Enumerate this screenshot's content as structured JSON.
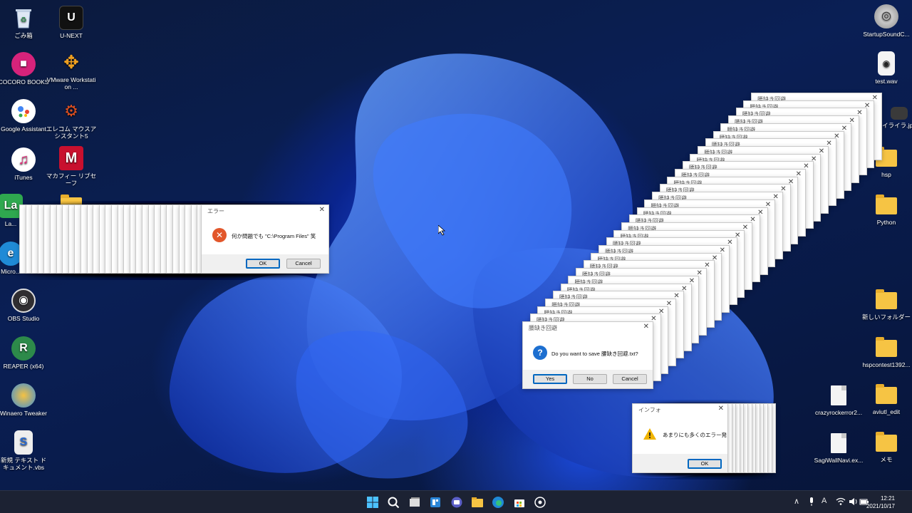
{
  "desktop": {
    "left_icons": [
      {
        "label": "ごみ箱",
        "icon": "recycle-bin-icon",
        "color": "#2b2b2b"
      },
      {
        "label": "U-NEXT",
        "icon": "unext-icon",
        "color": "#111111"
      },
      {
        "label": "COCORO BOOKS",
        "icon": "cocoro-books-icon",
        "color": "#d7237b"
      },
      {
        "label": "VMware Workstation ...",
        "icon": "vmware-icon",
        "color": "#f0a020"
      },
      {
        "label": "Google Assistant",
        "icon": "google-assistant-icon",
        "color": "#ffffff"
      },
      {
        "label": "エレコム マウスアシスタント5",
        "icon": "elecom-icon",
        "color": "#333333"
      },
      {
        "label": "iTunes",
        "icon": "itunes-icon",
        "color": "#ffffff"
      },
      {
        "label": "マカフィー リブセーフ",
        "icon": "mcafee-icon",
        "color": "#c8102e"
      },
      {
        "label": "La...",
        "icon": "la-icon",
        "color": "#2fa84f"
      },
      {
        "label": "Micro...",
        "icon": "edge-icon",
        "color": "#1f8ad6"
      },
      {
        "label": "OBS Studio",
        "icon": "obs-icon",
        "color": "#302e31"
      },
      {
        "label": "REAPER (x64)",
        "icon": "reaper-icon",
        "color": "#2d8a4a"
      },
      {
        "label": "Winaero Tweaker",
        "icon": "winaero-icon",
        "color": "#3c8fd8"
      },
      {
        "label": "新規 テキスト ドキュメント.vbs",
        "icon": "vbs-file-icon",
        "color": "#eeeeee"
      }
    ],
    "right_icons": [
      {
        "label": "StartupSoundC...",
        "icon": "startup-sound-icon"
      },
      {
        "label": "test.wav",
        "icon": "wav-file-icon"
      },
      {
        "label": "イライラ.jpg",
        "icon": "jpg-file-icon"
      },
      {
        "label": "hsp",
        "icon": "folder-icon"
      },
      {
        "label": "Python",
        "icon": "folder-icon"
      },
      {
        "label": "新しいフォルダー",
        "icon": "folder-icon"
      },
      {
        "label": "hspcontest1392...",
        "icon": "folder-icon"
      },
      {
        "label": "crazyrockerror2...",
        "icon": "file-icon"
      },
      {
        "label": "aviutl_edit",
        "icon": "folder-icon"
      },
      {
        "label": "SagiWallNavi.ex...",
        "icon": "file-icon"
      },
      {
        "label": "メモ",
        "icon": "folder-icon"
      }
    ]
  },
  "error_dialog": {
    "title": "エラー",
    "message": "何か問題でも \"C:\\Program Files\" 笑",
    "ok_label": "OK",
    "cancel_label": "Cancel",
    "stack_title_glyph": "エ",
    "icon": "error-x-icon"
  },
  "save_dialog": {
    "title": "腰缺き回避",
    "message": "Do you want to save 腰缺き回避.txt?",
    "yes_label": "Yes",
    "no_label": "No",
    "cancel_label": "Cancel",
    "icon": "question-icon"
  },
  "info_dialog": {
    "title": "インフォ",
    "message": "あまりにも多くのエラー発",
    "ok_label": "OK",
    "icon": "warning-icon"
  },
  "taskbar": {
    "icons": [
      "windows-start-icon",
      "search-icon",
      "task-view-icon",
      "widgets-icon",
      "teams-chat-icon",
      "file-explorer-icon",
      "edge-icon",
      "store-icon",
      "app-icon"
    ],
    "tray": {
      "ime": "A"
    },
    "time": "12:21",
    "date": "2021/10/17"
  },
  "colors": {
    "accent": "#0067c0",
    "error": "#e2572b",
    "question": "#1d6fd0",
    "warning": "#f0b400",
    "folder": "#f6c444"
  }
}
